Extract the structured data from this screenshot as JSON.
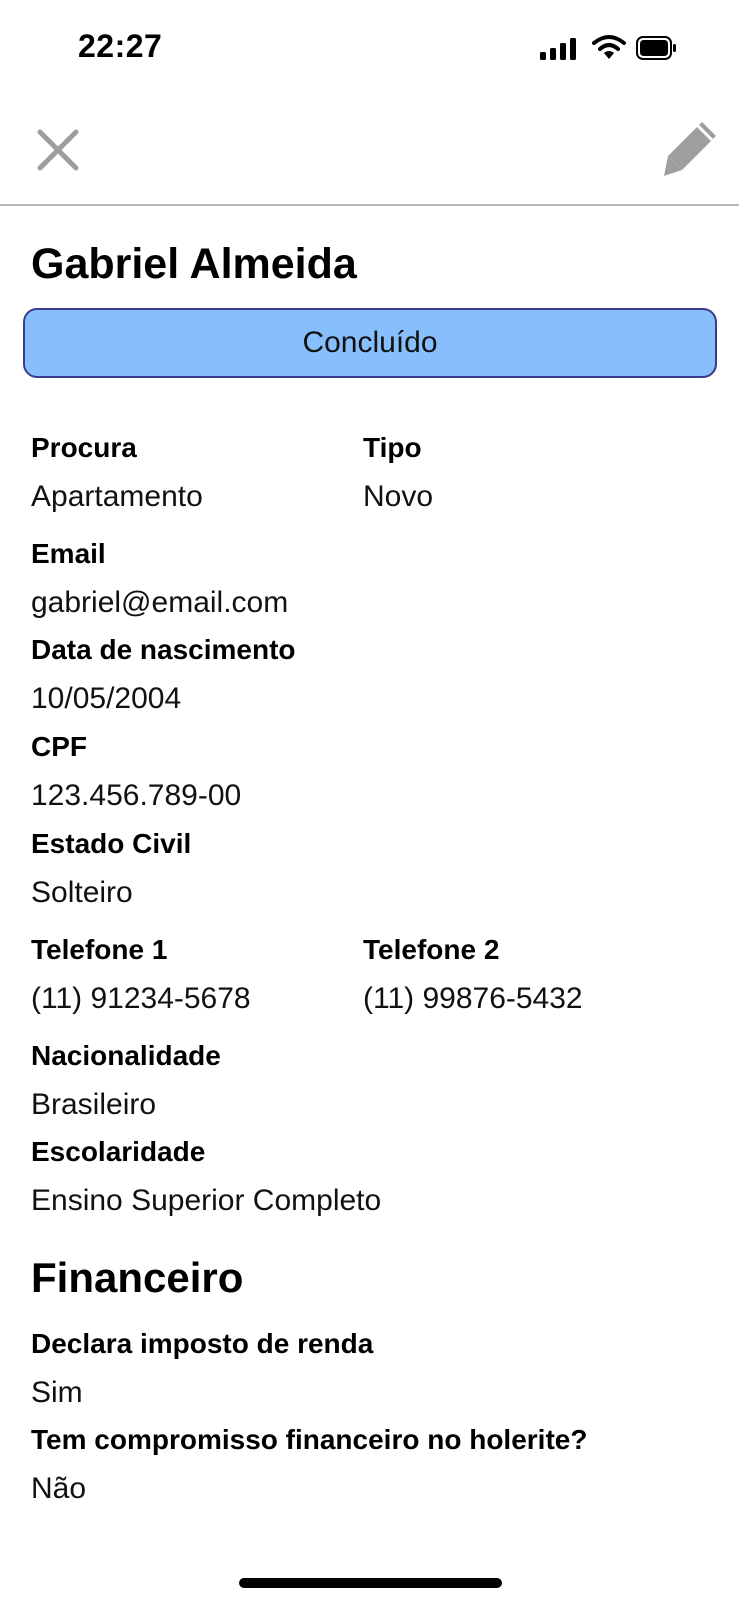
{
  "status_bar": {
    "time": "22:27"
  },
  "profile": {
    "name": "Gabriel Almeida",
    "status": "Concluído"
  },
  "fields": {
    "procura_label": "Procura",
    "procura_value": "Apartamento",
    "tipo_label": "Tipo",
    "tipo_value": "Novo",
    "email_label": "Email",
    "email_value": "gabriel@email.com",
    "nascimento_label": "Data de nascimento",
    "nascimento_value": "10/05/2004",
    "cpf_label": "CPF",
    "cpf_value": "123.456.789-00",
    "estado_civil_label": "Estado Civil",
    "estado_civil_value": "Solteiro",
    "telefone1_label": "Telefone 1",
    "telefone1_value": "(11) 91234-5678",
    "telefone2_label": "Telefone 2",
    "telefone2_value": "(11) 99876-5432",
    "nacionalidade_label": "Nacionalidade",
    "nacionalidade_value": "Brasileiro",
    "escolaridade_label": "Escolaridade",
    "escolaridade_value": "Ensino Superior Completo"
  },
  "financeiro": {
    "title": "Financeiro",
    "imposto_label": "Declara imposto de renda",
    "imposto_value": "Sim",
    "compromisso_label": "Tem compromisso financeiro no holerite?",
    "compromisso_value": "Não"
  },
  "icons": {
    "close": "close-icon",
    "edit": "pencil-icon",
    "signal": "cellular-signal-icon",
    "wifi": "wifi-icon",
    "battery": "battery-icon"
  },
  "colors": {
    "status_pill_bg": "#86bffc",
    "status_pill_border": "#3b3b8c",
    "icon_gray": "#9e9e9e"
  }
}
